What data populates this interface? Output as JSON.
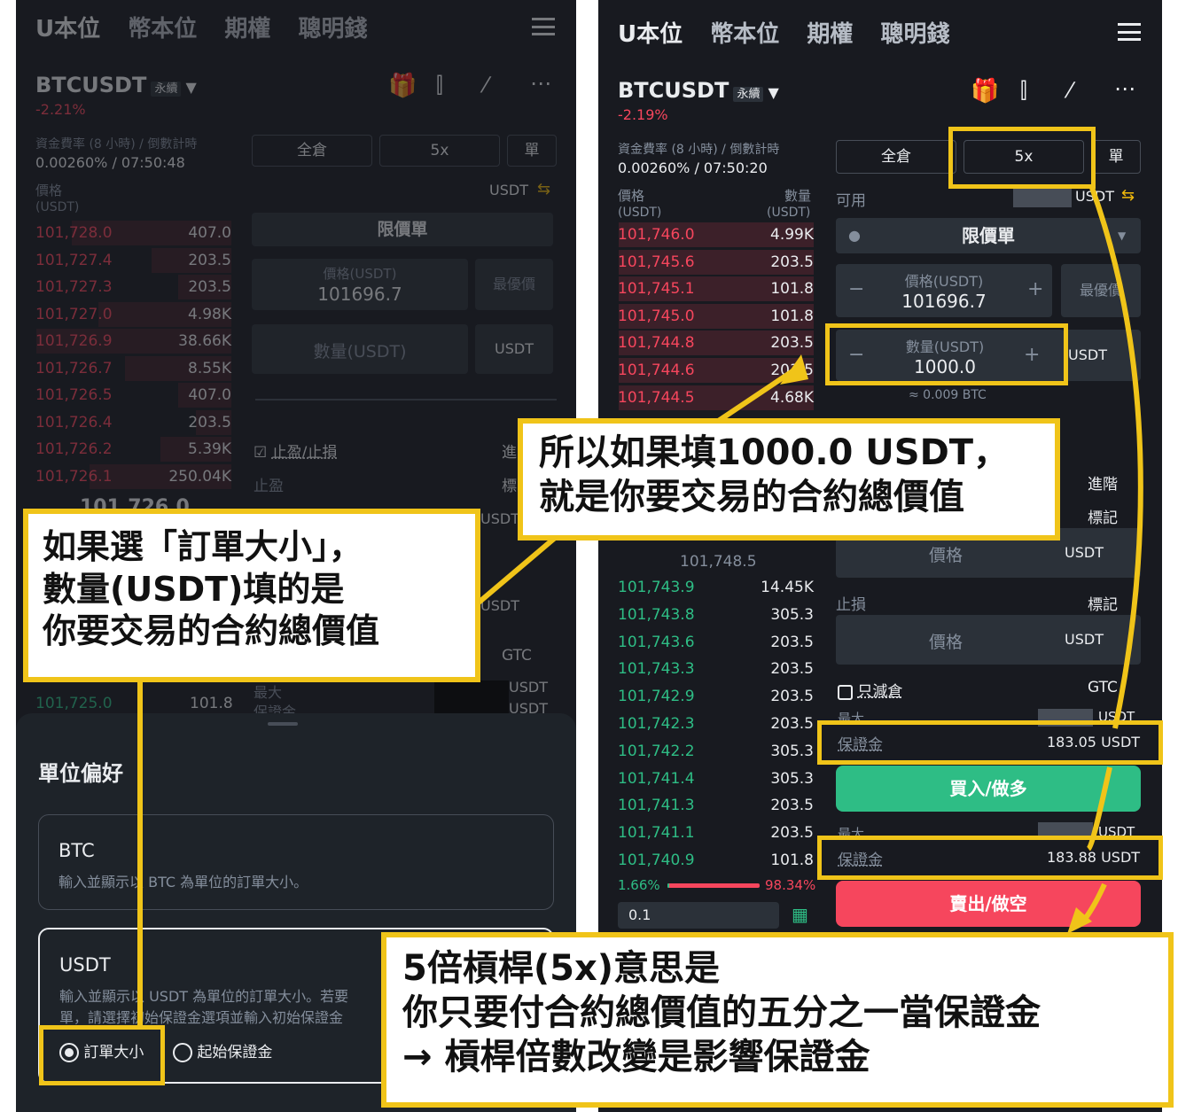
{
  "nav": {
    "items": [
      "U本位",
      "幣本位",
      "期權",
      "聰明錢"
    ]
  },
  "left": {
    "symbol": "BTCUSDT",
    "tag": "永續",
    "change": "-2.21%",
    "funding_label": "資金費率 (8 小時) / 倒數計時",
    "funding_value": "0.00260% / 07:50:48",
    "margin_mode": "全倉",
    "leverage": "5x",
    "mode_single": "單",
    "available_unit": "USDT",
    "price_header": "價格",
    "price_unit": "(USDT)",
    "order_type": "限價單",
    "price_field_label": "價格(USDT)",
    "price_field_value": "101696.7",
    "bbo": "最優價",
    "qty_placeholder": "數量(USDT)",
    "qty_unit": "USDT",
    "tpsl": "止盈/止損",
    "advanced": "進",
    "tp": "止盈",
    "mark": "標",
    "asks": [
      {
        "price": "101,728.0",
        "qty": "407.0"
      },
      {
        "price": "101,727.4",
        "qty": "203.5"
      },
      {
        "price": "101,727.3",
        "qty": "203.5"
      },
      {
        "price": "101,727.0",
        "qty": "4.98K"
      },
      {
        "price": "101,726.9",
        "qty": "38.66K"
      },
      {
        "price": "101,726.7",
        "qty": "8.55K"
      },
      {
        "price": "101,726.5",
        "qty": "407.0"
      },
      {
        "price": "101,726.4",
        "qty": "203.5"
      },
      {
        "price": "101,726.2",
        "qty": "5.39K"
      },
      {
        "price": "101,726.1",
        "qty": "250.04K"
      }
    ],
    "mid_price": "101,726.0",
    "last_bid": {
      "price": "101,725.0",
      "qty": "101.8"
    },
    "tif": "GTC",
    "max_label": "最大",
    "margin_label": "保證金",
    "usdt_a": "USDT",
    "usdt_b": "USDT",
    "usdt_c": "USDT",
    "usdt_d": "USDT",
    "sheet_title": "單位偏好",
    "opt_btc_title": "BTC",
    "opt_btc_desc": "輸入並顯示以 BTC 為單位的訂單大小。",
    "opt_usdt_title": "USDT",
    "opt_usdt_desc1": "輸入並顯示以 USDT 為單位的訂單大小。若要",
    "opt_usdt_desc2": "單，請選擇初始保證金選項並輸入初始保證金",
    "radio_order_size": "訂單大小",
    "radio_initial_margin": "起始保證金"
  },
  "right": {
    "symbol": "BTCUSDT",
    "tag": "永續",
    "change": "-2.19%",
    "funding_label": "資金費率 (8 小時) / 倒數計時",
    "funding_value": "0.00260% / 07:50:20",
    "margin_mode": "全倉",
    "leverage": "5x",
    "mode_single": "單",
    "available_label": "可用",
    "available_unit": "USDT",
    "price_header": "價格",
    "price_unit": "(USDT)",
    "qty_header": "數量",
    "qty_unit_header": "(USDT)",
    "order_type": "限價單",
    "price_field_label": "價格(USDT)",
    "price_field_value": "101696.7",
    "bbo": "最優價",
    "qty_field_label": "數量(USDT)",
    "qty_field_value": "1000.0",
    "qty_unit": "USDT",
    "btc_equiv": "≈ 0.009 BTC",
    "asks": [
      {
        "price": "101,746.0",
        "qty": "4.99K"
      },
      {
        "price": "101,745.6",
        "qty": "203.5"
      },
      {
        "price": "101,745.1",
        "qty": "101.8"
      },
      {
        "price": "101,745.0",
        "qty": "101.8"
      },
      {
        "price": "101,744.8",
        "qty": "203.5"
      },
      {
        "price": "101,744.6",
        "qty": "203.5"
      },
      {
        "price": "101,744.5",
        "qty": "4.68K"
      }
    ],
    "mid_sub": "101,748.5",
    "bids": [
      {
        "price": "101,743.9",
        "qty": "14.45K"
      },
      {
        "price": "101,743.8",
        "qty": "305.3"
      },
      {
        "price": "101,743.6",
        "qty": "203.5"
      },
      {
        "price": "101,743.3",
        "qty": "203.5"
      },
      {
        "price": "101,742.9",
        "qty": "203.5"
      },
      {
        "price": "101,742.3",
        "qty": "203.5"
      },
      {
        "price": "101,742.2",
        "qty": "305.3"
      },
      {
        "price": "101,741.4",
        "qty": "305.3"
      },
      {
        "price": "101,741.3",
        "qty": "203.5"
      },
      {
        "price": "101,741.1",
        "qty": "203.5"
      },
      {
        "price": "101,740.9",
        "qty": "101.8"
      }
    ],
    "ratio_buy": "1.66%",
    "ratio_sell": "98.34%",
    "ratio_buy_fraction": 0.0166,
    "depth_step": "0.1",
    "advanced": "進階",
    "mark": "標記",
    "tp_price_placeholder": "價格",
    "tp_unit": "USDT",
    "sl_label": "止損",
    "sl_mark": "標記",
    "sl_price_placeholder": "價格",
    "sl_unit": "USDT",
    "reduce_only": "只減倉",
    "tif": "GTC",
    "max_label": "最大",
    "max_unit": "USDT",
    "buy_margin_label": "保證金",
    "buy_margin_value": "183.05 USDT",
    "buy_button": "買入/做多",
    "sell_margin_label": "保證金",
    "sell_margin_value": "183.88 USDT",
    "sell_button": "賣出/做空"
  },
  "callouts": {
    "left_line1": "如果選「訂單大小」，",
    "left_line2": "數量(USDT)填的是",
    "left_line3": "你要交易的合約總價值",
    "mid_line1": "所以如果填1000.0 USDT，",
    "mid_line2": "就是你要交易的合約總價值",
    "bottom_line1": "5倍槓桿(5x)意思是",
    "bottom_line2": "你只要付合約總價值的五分之一當保證金",
    "bottom_line3": "→ 槓桿倍數改變是影響保證金"
  },
  "colors": {
    "accent": "#f0c419",
    "bg": "#181a20",
    "buy": "#2ebd85",
    "sell": "#f6465d"
  }
}
